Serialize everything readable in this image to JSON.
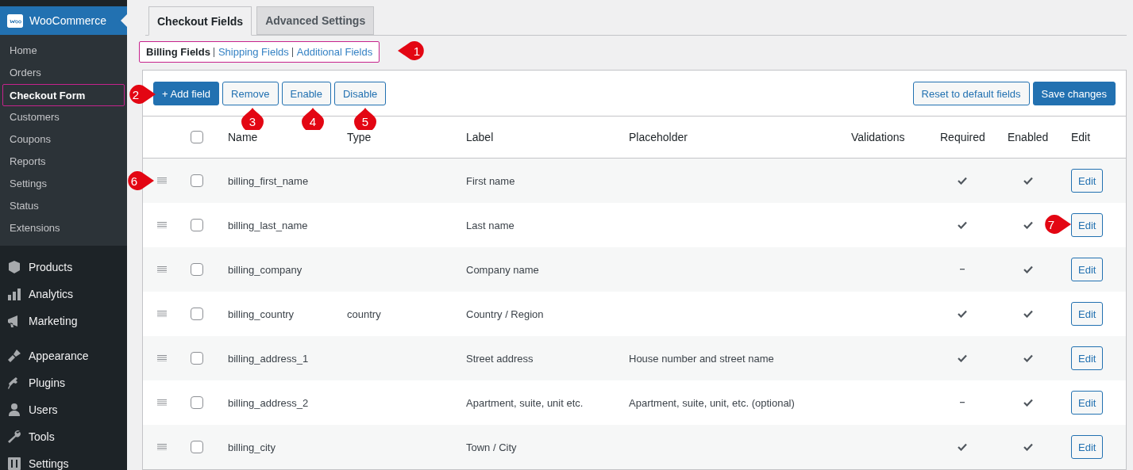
{
  "sidebar": {
    "current": {
      "label": "WooCommerce",
      "selected": true
    },
    "submenu": [
      {
        "label": "Home",
        "selected": false
      },
      {
        "label": "Orders",
        "selected": false
      },
      {
        "label": "Checkout Form",
        "selected": true
      },
      {
        "label": "Customers",
        "selected": false
      },
      {
        "label": "Coupons",
        "selected": false
      },
      {
        "label": "Reports",
        "selected": false
      },
      {
        "label": "Settings",
        "selected": false
      },
      {
        "label": "Status",
        "selected": false
      },
      {
        "label": "Extensions",
        "selected": false
      }
    ],
    "groups": [
      [
        {
          "label": "Products"
        },
        {
          "label": "Analytics"
        },
        {
          "label": "Marketing"
        }
      ],
      [
        {
          "label": "Appearance"
        },
        {
          "label": "Plugins"
        },
        {
          "label": "Users"
        },
        {
          "label": "Tools"
        },
        {
          "label": "Settings"
        }
      ]
    ]
  },
  "tabs": [
    {
      "label": "Checkout Fields",
      "selected": true
    },
    {
      "label": "Advanced Settings",
      "selected": false
    }
  ],
  "subnav": [
    {
      "label": "Billing Fields",
      "selected": true
    },
    {
      "label": "Shipping Fields",
      "selected": false
    },
    {
      "label": "Additional Fields",
      "selected": false
    }
  ],
  "toolbar": {
    "left": [
      {
        "label": "+ Add field",
        "kind": "primary"
      },
      {
        "label": "Remove",
        "kind": "secondary"
      },
      {
        "label": "Enable",
        "kind": "secondary"
      },
      {
        "label": "Disable",
        "kind": "secondary"
      }
    ],
    "right": [
      {
        "label": "Reset to default fields",
        "kind": "secondary"
      },
      {
        "label": "Save changes",
        "kind": "primary"
      }
    ]
  },
  "table": {
    "select_all": {
      "checked": false
    },
    "columns": [
      "Name",
      "Type",
      "Label",
      "Placeholder",
      "Validations",
      "Required",
      "Enabled",
      "Edit"
    ],
    "rows": [
      {
        "name": "billing_first_name",
        "label": "First name",
        "required": true,
        "enabled": true,
        "checked": false,
        "action": "Edit"
      },
      {
        "name": "billing_last_name",
        "label": "Last name",
        "required": true,
        "enabled": true,
        "checked": false,
        "action": "Edit"
      },
      {
        "name": "billing_company",
        "label": "Company name",
        "required": false,
        "enabled": true,
        "checked": false,
        "action": "Edit"
      },
      {
        "name": "billing_country",
        "type": "country",
        "label": "Country / Region",
        "required": true,
        "enabled": true,
        "checked": false,
        "action": "Edit"
      },
      {
        "name": "billing_address_1",
        "label": "Street address",
        "placeholder": "House number and street name",
        "required": true,
        "enabled": true,
        "checked": false,
        "action": "Edit"
      },
      {
        "name": "billing_address_2",
        "label": "Apartment, suite, unit etc.",
        "placeholder": "Apartment, suite, unit, etc. (optional)",
        "required": false,
        "enabled": true,
        "checked": false,
        "action": "Edit"
      },
      {
        "name": "billing_city",
        "label": "Town / City",
        "required": true,
        "enabled": true,
        "checked": false,
        "action": "Edit"
      }
    ]
  },
  "callouts": [
    {
      "number": "1"
    },
    {
      "number": "2"
    },
    {
      "number": "3"
    },
    {
      "number": "4"
    },
    {
      "number": "5"
    },
    {
      "number": "6"
    },
    {
      "number": "7"
    }
  ]
}
